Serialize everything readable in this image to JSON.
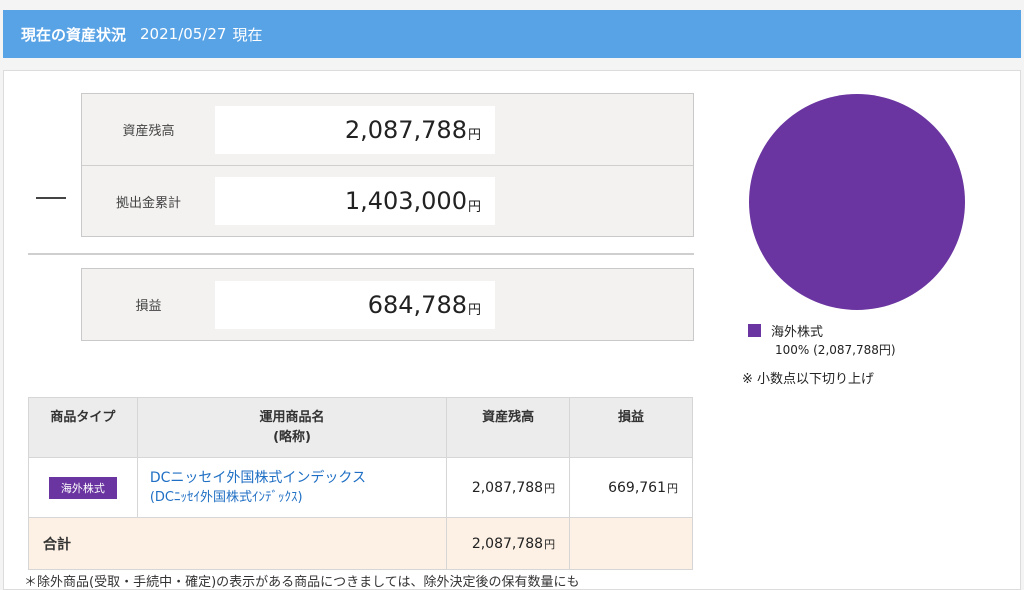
{
  "header": {
    "title": "現在の資産状況",
    "date": "2021/05/27",
    "as_of": "現在"
  },
  "summary": {
    "balance": {
      "label": "資産残高",
      "value": "2,087,788",
      "unit": "円"
    },
    "contributions": {
      "label": "拠出金累計",
      "value": "1,403,000",
      "unit": "円"
    },
    "profit": {
      "label": "損益",
      "value": "684,788",
      "unit": "円"
    }
  },
  "pie": {
    "colors": {
      "overseas_stocks": "#6a35a0"
    },
    "legend_label": "海外株式",
    "legend_detail": "100% (2,087,788円)"
  },
  "note": "※ 小数点以下切り上げ",
  "table": {
    "headers": {
      "type": "商品タイプ",
      "name_line1": "運用商品名",
      "name_line2": "(略称)",
      "balance": "資産残高",
      "profit": "損益"
    },
    "rows": [
      {
        "type": "海外株式",
        "name": "DCニッセイ外国株式インデックス",
        "short_name": "(DCﾆｯｾｲ外国株式ｲﾝﾃﾞｯｸｽ)",
        "balance": "2,087,788",
        "profit": "669,761",
        "unit": "円"
      }
    ],
    "total": {
      "label": "合計",
      "balance": "2,087,788",
      "unit": "円"
    }
  },
  "footnote": "＊除外商品(受取・手続中・確定)の表示がある商品につきましては、除外決定後の保有数量にも"
}
